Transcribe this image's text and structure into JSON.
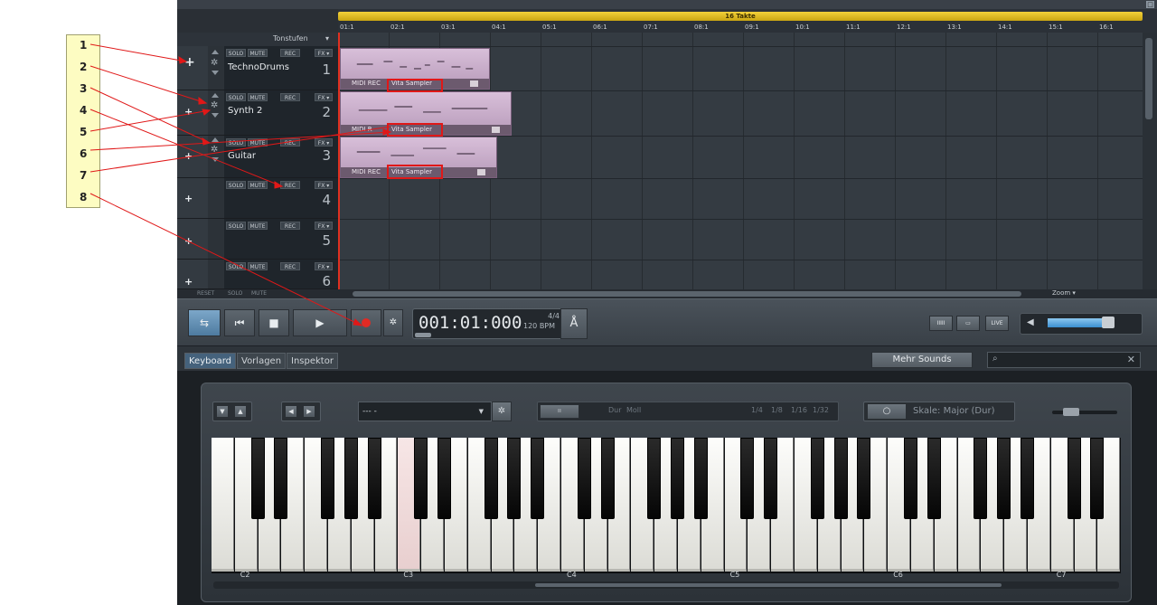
{
  "window": {
    "close_glyph": "□"
  },
  "callouts": [
    "1",
    "2",
    "3",
    "4",
    "5",
    "6",
    "7",
    "8"
  ],
  "arrange": {
    "loop_label": "16 Takte",
    "ruler": [
      "01:1",
      "02:1",
      "03:1",
      "04:1",
      "05:1",
      "06:1",
      "07:1",
      "08:1",
      "09:1",
      "10:1",
      "11:1",
      "12:1",
      "13:1",
      "14:1",
      "15:1",
      "16:1"
    ],
    "tonstufen_label": "Tonstufen",
    "tonstufen_caret": "▾",
    "track_buttons": {
      "solo": "SOLO",
      "mute": "MUTE",
      "rec": "REC",
      "fx": "FX ▾"
    },
    "tracks": [
      {
        "name": "TechnoDrums",
        "number": "1"
      },
      {
        "name": "Synth 2",
        "number": "2"
      },
      {
        "name": "Guitar",
        "number": "3"
      },
      {
        "name": "",
        "number": "4"
      },
      {
        "name": "",
        "number": "5"
      },
      {
        "name": "",
        "number": "6"
      }
    ],
    "clips": [
      {
        "left_label": "MIDI REC",
        "instrument": "Vita Sampler"
      },
      {
        "left_label": "MIDI R",
        "instrument": "Vita Sampler"
      },
      {
        "left_label": "MIDI REC",
        "instrument": "Vita Sampler"
      }
    ],
    "footer": {
      "reset": "RESET",
      "solo": "SOLO",
      "mute": "MUTE"
    },
    "zoom_label": "Zoom ▾"
  },
  "transport": {
    "time": "001:01:000",
    "signature": "4/4",
    "bpm": "120 BPM",
    "metronome_glyph": "Å",
    "view_buttons": [
      "IIIII",
      "▭",
      "LIVE"
    ],
    "volume_level": 0.62
  },
  "tabs": [
    "Keyboard",
    "Vorlagen",
    "Inspektor"
  ],
  "more_sounds": "Mehr Sounds",
  "search": {
    "placeholder": ""
  },
  "keyboard": {
    "preset": "--- -",
    "arp_labels": [
      "Dur",
      "Moll",
      "1/4",
      "1/8",
      "1/16",
      "1/32"
    ],
    "scale": "Skale: Major (Dur)",
    "octave_labels": [
      "C2",
      "C3",
      "C4",
      "C5",
      "C6",
      "C7"
    ]
  }
}
